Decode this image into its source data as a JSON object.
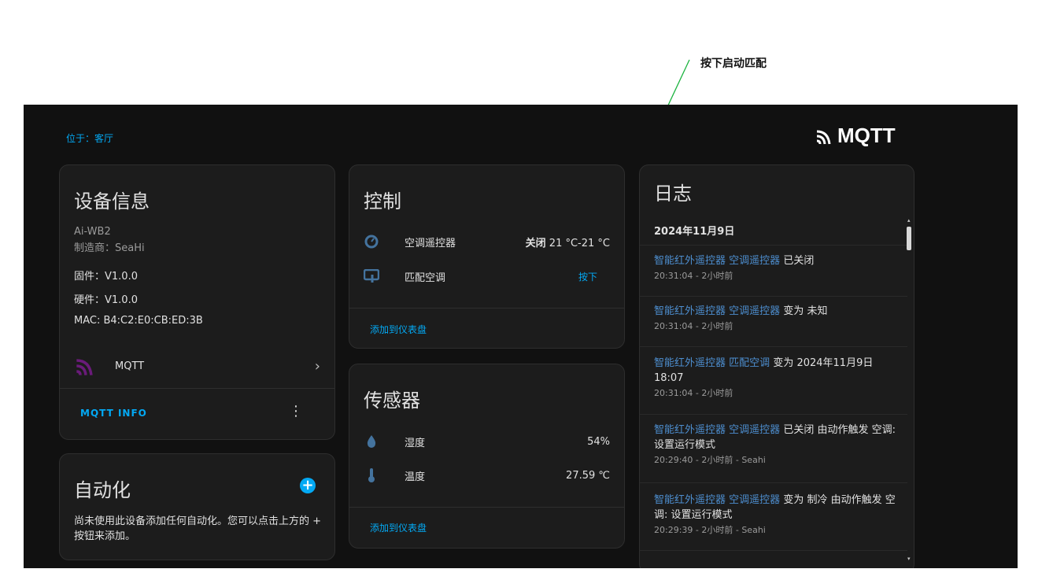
{
  "annotation": {
    "text": "按下启动匹配"
  },
  "header": {
    "location": "位于：客厅",
    "logo_text": "MQTT"
  },
  "device_info": {
    "title": "设备信息",
    "model": "Ai-WB2",
    "manufacturer": "制造商：SeaHi",
    "firmware": "固件：V1.0.0",
    "hardware": "硬件：V1.0.0",
    "mac": "MAC: B4:C2:E0:CB:ED:3B",
    "integration_label": "MQTT",
    "info_button": "MQTT INFO"
  },
  "automation": {
    "title": "自动化",
    "description": "尚未使用此设备添加任何自动化。您可以点击上方的 + 按钮来添加。"
  },
  "control": {
    "title": "控制",
    "rows": [
      {
        "icon": "thermostat-icon",
        "name": "空调遥控器",
        "state_bold": "关闭",
        "state_rest": " 21 °C-21 °C"
      },
      {
        "icon": "remote-touch-icon",
        "name": "匹配空调",
        "state": "按下"
      }
    ],
    "add_to_dashboard": "添加到仪表盘"
  },
  "sensors": {
    "title": "传感器",
    "rows": [
      {
        "icon": "humidity-icon",
        "name": "湿度",
        "value": "54%"
      },
      {
        "icon": "thermometer-icon",
        "name": "温度",
        "value": "27.59 ℃"
      }
    ],
    "add_to_dashboard": "添加到仪表盘"
  },
  "log": {
    "title": "日志",
    "date": "2024年11月9日",
    "entries": [
      {
        "device": "智能红外遥控器",
        "entity": "空调遥控器",
        "action": "已关闭",
        "meta": "20:31:04 - 2小时前"
      },
      {
        "device": "智能红外遥控器",
        "entity": "空调遥控器",
        "action": "变为 未知",
        "meta": "20:31:04 - 2小时前"
      },
      {
        "device": "智能红外遥控器",
        "entity": "匹配空调",
        "action": "变为 2024年11月9日 18:07",
        "meta": "20:31:04 - 2小时前"
      },
      {
        "device": "智能红外遥控器",
        "entity": "空调遥控器",
        "action": "已关闭 由动作触发 空调: 设置运行模式",
        "meta": "20:29:40 - 2小时前 - Seahi"
      },
      {
        "device": "智能红外遥控器",
        "entity": "空调遥控器",
        "action": "变为 制冷 由动作触发 空调: 设置运行模式",
        "meta": "20:29:39 - 2小时前 - Seahi"
      }
    ]
  },
  "colors": {
    "accent": "#03a9f4",
    "background": "#111111",
    "card": "#1c1c1c",
    "annotation_line": "#1bb33f"
  }
}
